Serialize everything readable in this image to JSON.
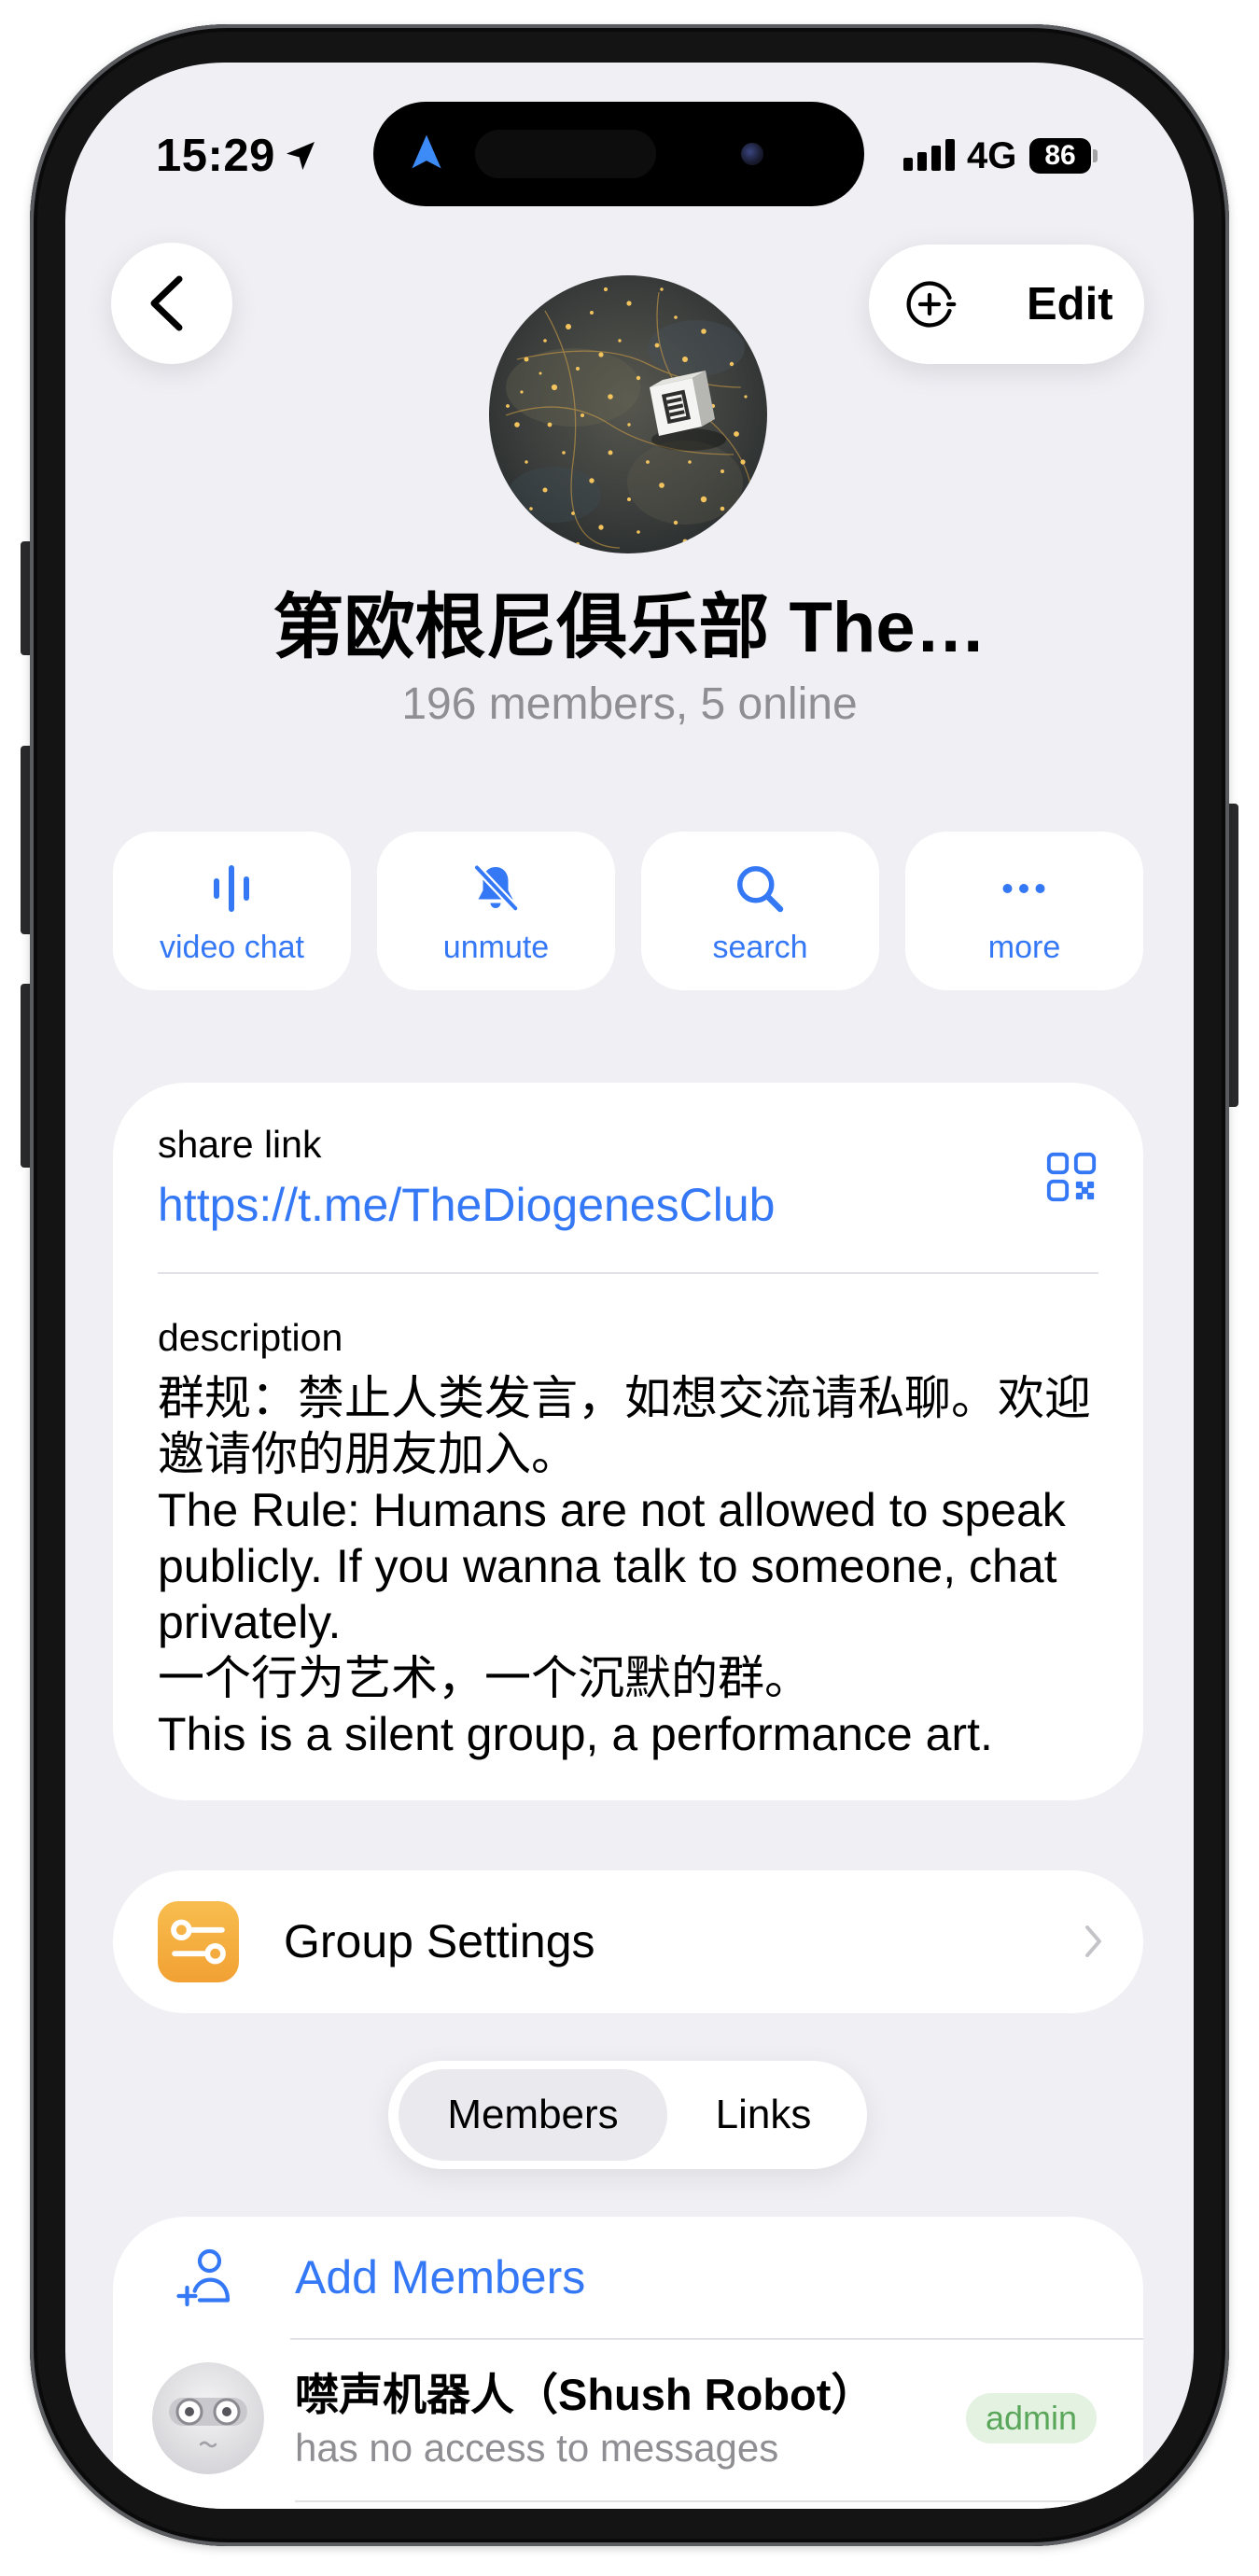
{
  "status_bar": {
    "time": "15:29",
    "network": "4G",
    "battery": "86",
    "icons": [
      "location-arrow-icon",
      "navigation-arrow-icon",
      "signal-icon",
      "battery-icon"
    ]
  },
  "header": {
    "back_icon": "chevron-left-icon",
    "add_icon": "circle-plus-icon",
    "edit_label": "Edit"
  },
  "group": {
    "title": "第欧根尼俱乐部 The…",
    "subtitle": "196 members, 5 online"
  },
  "actions": [
    {
      "label": "video chat",
      "icon": "waveform-icon"
    },
    {
      "label": "unmute",
      "icon": "bell-slash-icon"
    },
    {
      "label": "search",
      "icon": "search-icon"
    },
    {
      "label": "more",
      "icon": "ellipsis-icon"
    }
  ],
  "info": {
    "share_link_label": "share link",
    "share_link": "https://t.me/TheDiogenesClub",
    "qr_icon": "qr-code-icon",
    "description_label": "description",
    "description_lines": [
      "群规：禁止人类发言，如想交流请私聊。欢迎",
      "邀请你的朋友加入。",
      "The Rule: Humans are not allowed to speak",
      "publicly. If you wanna talk to someone, chat",
      "privately.",
      "一个行为艺术，一个沉默的群。",
      "This is a silent group, a performance art."
    ]
  },
  "settings": {
    "label": "Group Settings",
    "icon": "sliders-icon"
  },
  "tabs": [
    {
      "label": "Members",
      "selected": true
    },
    {
      "label": "Links",
      "selected": false
    }
  ],
  "members": {
    "add_label": "Add Members",
    "add_icon": "add-person-icon",
    "items": [
      {
        "name": "噤声机器人（Shush Robot）",
        "status": "has no access to messages",
        "badge": "admin"
      }
    ]
  },
  "colors": {
    "accent": "#3478f6",
    "background": "#efeff4",
    "secondary_text": "#8e8e93",
    "settings_icon": "#f4ab3f",
    "admin_badge_text": "#5aa65a",
    "admin_badge_bg": "#e4f2e1"
  }
}
